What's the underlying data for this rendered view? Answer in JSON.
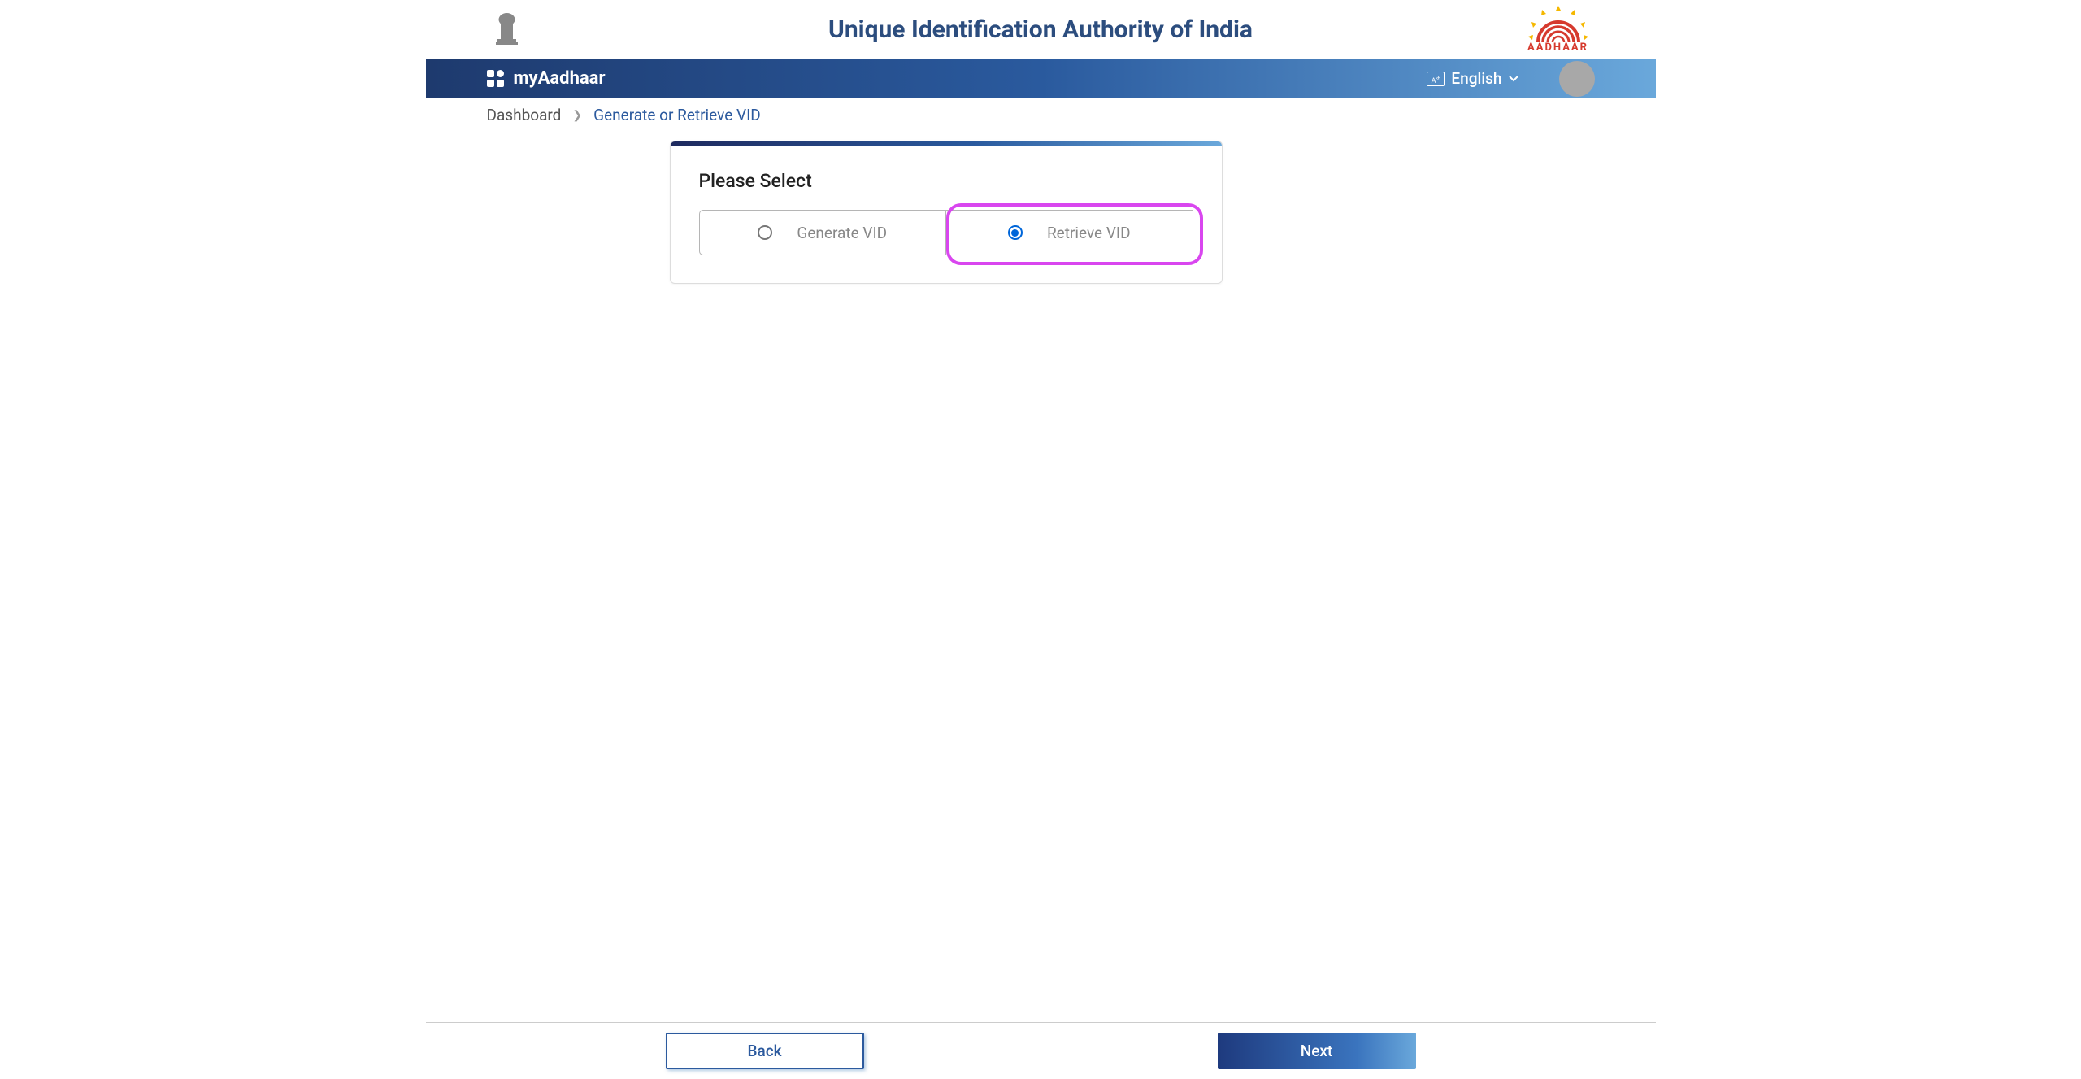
{
  "header": {
    "title": "Unique Identification Authority of India",
    "aadhaar_label": "AADHAAR"
  },
  "nav": {
    "app_name": "myAadhaar",
    "language": "English"
  },
  "breadcrumb": {
    "items": [
      "Dashboard",
      "Generate or Retrieve VID"
    ]
  },
  "card": {
    "title": "Please Select",
    "options": {
      "generate": "Generate VID",
      "retrieve": "Retrieve VID"
    },
    "selected": "retrieve"
  },
  "footer": {
    "back": "Back",
    "next": "Next"
  }
}
